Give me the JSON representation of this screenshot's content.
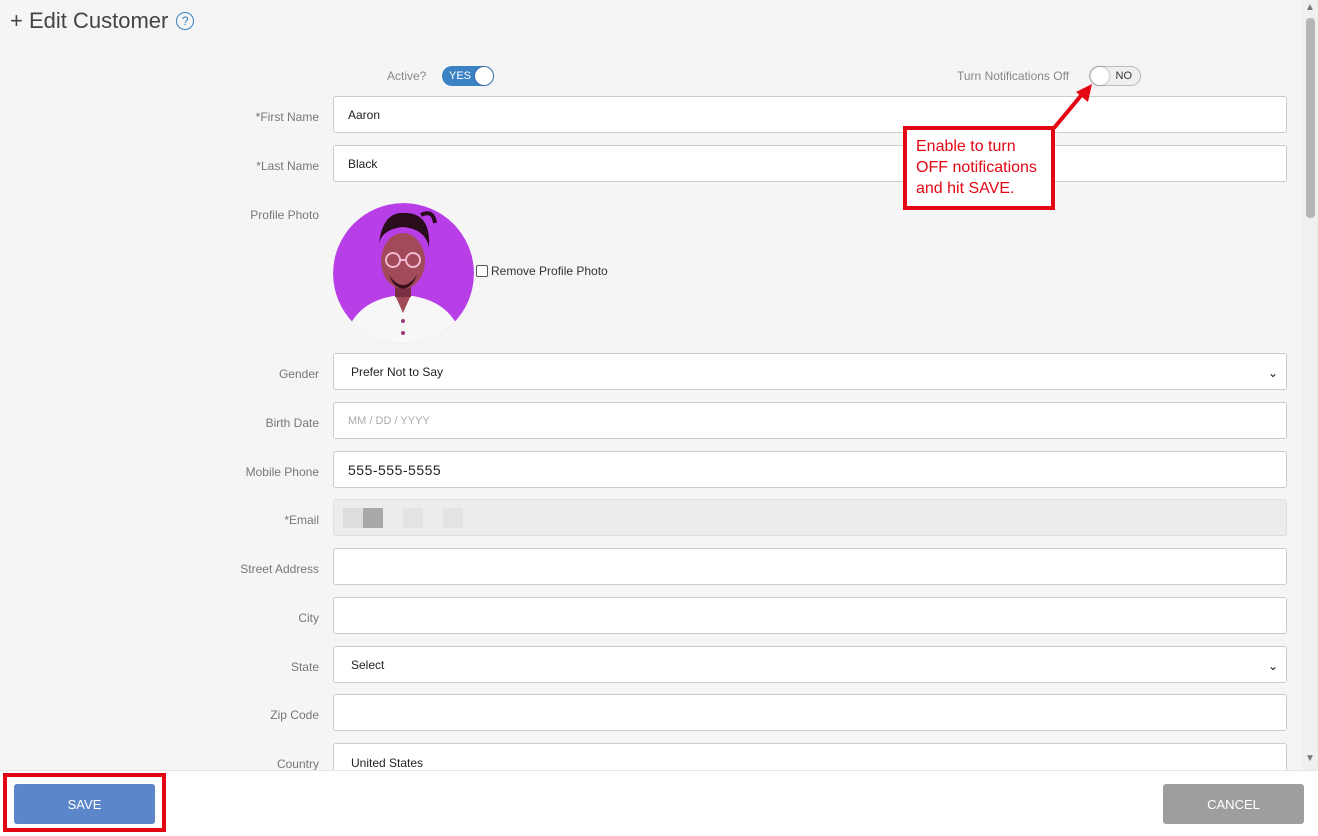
{
  "header": {
    "title": "+ Edit Customer",
    "help_icon": "question-circle-icon"
  },
  "toggles": {
    "active": {
      "label": "Active?",
      "value": "YES",
      "on": true,
      "color": "#3b82c4"
    },
    "notifications": {
      "label": "Turn Notifications Off",
      "value": "NO",
      "on": false
    }
  },
  "form": {
    "first_name": {
      "label": "*First Name",
      "value": "Aaron"
    },
    "last_name": {
      "label": "*Last Name",
      "value": "Black"
    },
    "profile_photo": {
      "label": "Profile Photo",
      "remove_label": "Remove Profile Photo",
      "remove_checked": false
    },
    "gender": {
      "label": "Gender",
      "value": "Prefer Not to Say"
    },
    "birth_date": {
      "label": "Birth Date",
      "placeholder": "MM / DD / YYYY"
    },
    "mobile_phone": {
      "label": "Mobile Phone",
      "value": "555-555-5555"
    },
    "email": {
      "label": "*Email"
    },
    "street_address": {
      "label": "Street Address",
      "value": ""
    },
    "city": {
      "label": "City",
      "value": ""
    },
    "state": {
      "label": "State",
      "value": "Select"
    },
    "zip_code": {
      "label": "Zip Code",
      "value": ""
    },
    "country": {
      "label": "Country",
      "value": "United States"
    }
  },
  "callout": {
    "line1": "Enable to turn",
    "line2": "OFF notifications",
    "line3": "and hit SAVE.",
    "color": "#e30613"
  },
  "footer": {
    "save_label": "SAVE",
    "cancel_label": "CANCEL"
  },
  "colors": {
    "save": "#5b86c9",
    "cancel": "#9e9e9e",
    "avatar_bg": "#b83ee8"
  }
}
